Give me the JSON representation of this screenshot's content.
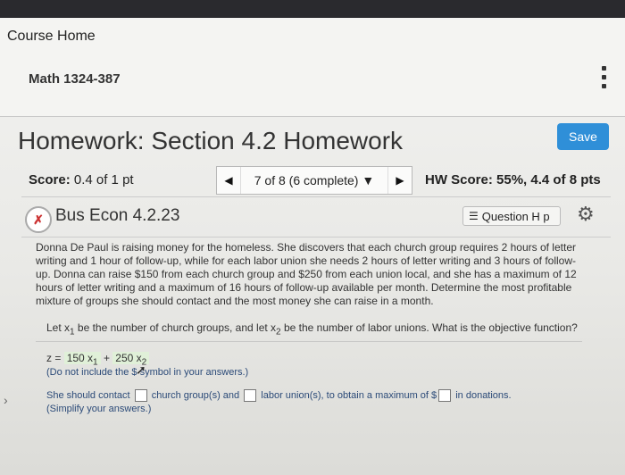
{
  "header": {
    "course_home": "Course Home",
    "course_id": "Math 1324-387"
  },
  "homework": {
    "title": "Homework: Section 4.2 Homework",
    "save_label": "Save"
  },
  "score": {
    "label": "Score:",
    "value": "0.4 of 1 pt"
  },
  "question_nav": {
    "text": "7 of 8 (6 complete)",
    "dropdown": "▼",
    "prev": "◀",
    "next": "▶"
  },
  "hw_score": {
    "label": "HW Score:",
    "value": "55%, 4.4 of 8 pts"
  },
  "question": {
    "icon_text": "✗",
    "name": "Bus Econ 4.2.23",
    "help_label": "Question H  p"
  },
  "problem_text": "Donna De Paul is raising money for the homeless. She discovers that each church group requires 2 hours of letter writing and 1 hour of follow-up, while for each labor union she needs 2 hours of letter writing and 3 hours of follow-up. Donna can raise $150 from each church group and $250 from each union local, and she has a maximum of 12 hours of letter writing and a maximum of 16 hours of follow-up available per month. Determine the most profitable mixture of groups she should contact and the most money she can raise in a month.",
  "prompt": {
    "p1": "Let x",
    "s1": "1",
    "p2": " be the number of church groups, and let x",
    "s2": "2",
    "p3": " be the number of labor unions. What is the objective function?"
  },
  "answer": {
    "z_label": "z =",
    "t1": "150 x",
    "s1": "1",
    "plus": " + ",
    "t2": "250 x",
    "s2": "2",
    "note": "(Do not include the $ symbol in your answers.)"
  },
  "fill": {
    "p1": "She should contact",
    "p2": "church group(s) and",
    "p3": "labor union(s), to obtain a maximum of $",
    "p4": "in donations.",
    "simplify": "(Simplify your answers.)"
  }
}
